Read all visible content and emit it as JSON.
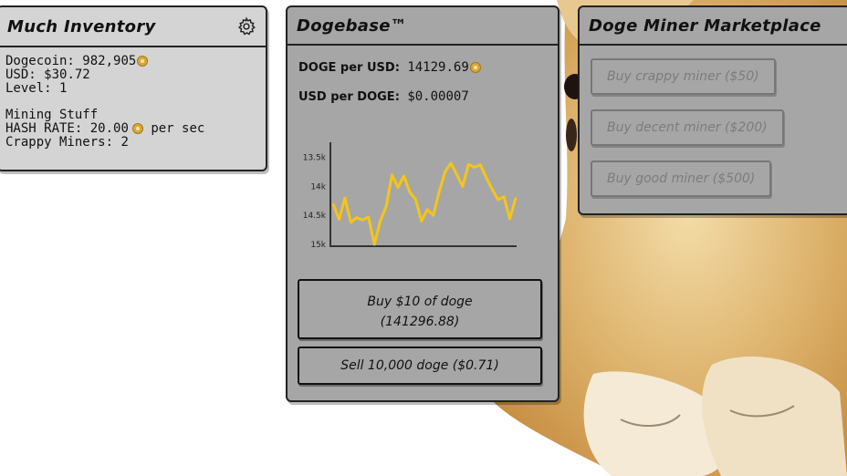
{
  "inventory": {
    "title": "Much Inventory",
    "dogecoin_label": "Dogecoin:",
    "dogecoin_value": "982,905",
    "usd_label": "USD:",
    "usd_value": "$30.72",
    "level_label": "Level:",
    "level_value": "1",
    "mining_heading": "Mining Stuff",
    "hash_label": "HASH RATE:",
    "hash_value": "20.00",
    "hash_unit": "per sec",
    "miners_label": "Crappy Miners:",
    "miners_value": "2",
    "settings_icon": "gear-icon"
  },
  "dogebase": {
    "title": "Dogebase™",
    "doge_per_usd_label": "DOGE per USD:",
    "doge_per_usd_value": "14129.69",
    "usd_per_doge_label": "USD per DOGE:",
    "usd_per_doge_value": "$0.00007",
    "buy_line1": "Buy $10 of doge",
    "buy_line2": "(141296.88)",
    "sell_label": "Sell 10,000 doge ($0.71)"
  },
  "market": {
    "title": "Doge Miner Marketplace",
    "buttons": [
      {
        "label": "Buy crappy miner ($50)"
      },
      {
        "label": "Buy decent miner ($200)"
      },
      {
        "label": "Buy good miner ($500)"
      }
    ]
  },
  "chart_data": {
    "type": "line",
    "y_ticks": [
      "13.5k",
      "14k",
      "14.5k",
      "15k"
    ],
    "ylim": [
      15000,
      13350
    ],
    "y_inverted": true,
    "line_color": "#f5c518",
    "values": [
      14300,
      14570,
      14200,
      14620,
      14540,
      14580,
      14530,
      15000,
      14600,
      14350,
      13800,
      14020,
      13820,
      14100,
      14220,
      14600,
      14400,
      14500,
      14100,
      13750,
      13600,
      13800,
      14000,
      13620,
      13670,
      13630,
      13850,
      14050,
      14230,
      14180,
      14560,
      14200
    ]
  }
}
